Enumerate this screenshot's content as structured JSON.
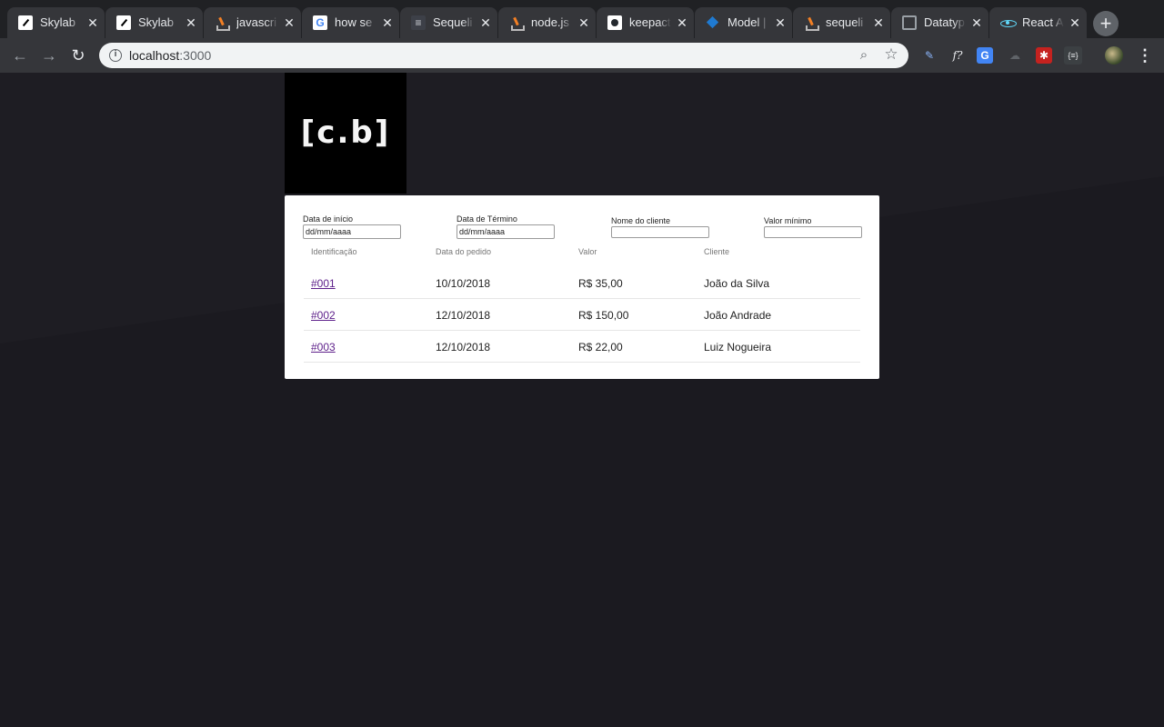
{
  "browser": {
    "tabs": [
      {
        "title": "Skylab",
        "favicon": "skylab-icon"
      },
      {
        "title": "Skylab",
        "favicon": "skylab-icon"
      },
      {
        "title": "javascri",
        "favicon": "stackoverflow-icon"
      },
      {
        "title": "how se",
        "favicon": "google-icon"
      },
      {
        "title": "Sequeli",
        "favicon": "sequelize-icon"
      },
      {
        "title": "node.js",
        "favicon": "stackoverflow-icon"
      },
      {
        "title": "keepact",
        "favicon": "github-icon"
      },
      {
        "title": "Model |",
        "favicon": "model-icon"
      },
      {
        "title": "sequeli",
        "favicon": "stackoverflow-icon"
      },
      {
        "title": "Datatyp",
        "favicon": "datatype-icon"
      },
      {
        "title": "React A",
        "favicon": "react-icon"
      }
    ],
    "active_tab": 10,
    "close_glyph": "✕",
    "newtab_glyph": "+",
    "address": {
      "host": "localhost",
      "port": ":3000"
    },
    "extensions": [
      {
        "name": "pen-extension-icon",
        "glyph": "✎",
        "color": "#8ab4f8"
      },
      {
        "name": "function-extension-icon",
        "glyph": "f?",
        "color": "#e8eaed"
      },
      {
        "name": "translate-extension-icon",
        "glyph": "G",
        "color": "#4285f4"
      },
      {
        "name": "cloud-extension-icon",
        "glyph": "☁",
        "color": "#5f6368"
      },
      {
        "name": "bug-extension-icon",
        "glyph": "✱",
        "color": "#d93025"
      },
      {
        "name": "json-extension-icon",
        "glyph": "{≡}",
        "color": "#e8eaed"
      }
    ]
  },
  "app": {
    "logo_text": "[c.b]",
    "filters": [
      {
        "label": "Data de início",
        "value": "dd/mm/aaaa"
      },
      {
        "label": "Data de Término",
        "value": "dd/mm/aaaa"
      },
      {
        "label": "Nome do cliente",
        "value": ""
      },
      {
        "label": "Valor mínimo",
        "value": ""
      }
    ],
    "table": {
      "headers": [
        "Identificação",
        "Data do pedido",
        "Valor",
        "Cliente"
      ],
      "rows": [
        {
          "id": "#001",
          "date": "10/10/2018",
          "value": "R$ 35,00",
          "client": "João da Silva"
        },
        {
          "id": "#002",
          "date": "12/10/2018",
          "value": "R$ 150,00",
          "client": "João Andrade"
        },
        {
          "id": "#003",
          "date": "12/10/2018",
          "value": "R$ 22,00",
          "client": "Luiz Nogueira"
        }
      ]
    }
  }
}
